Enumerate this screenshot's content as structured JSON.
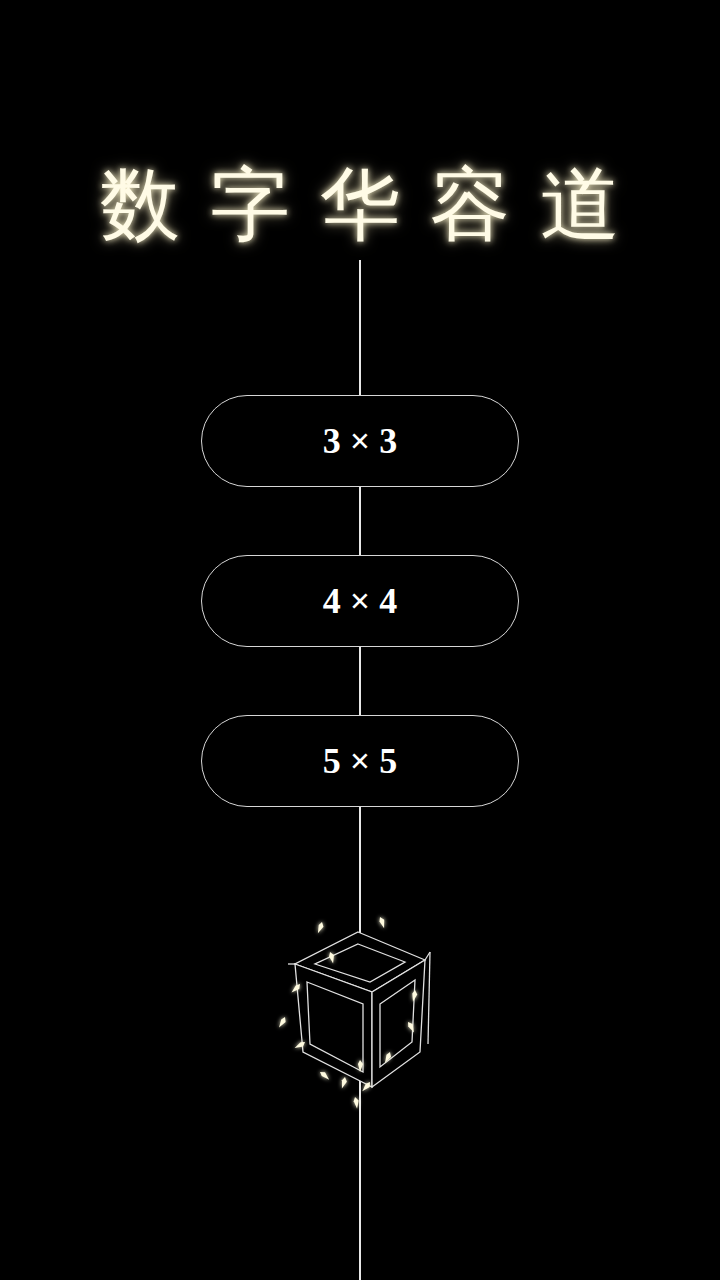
{
  "title": "数字华容道",
  "modes": [
    {
      "label": "3 × 3"
    },
    {
      "label": "4 × 4"
    },
    {
      "label": "5 × 5"
    }
  ]
}
